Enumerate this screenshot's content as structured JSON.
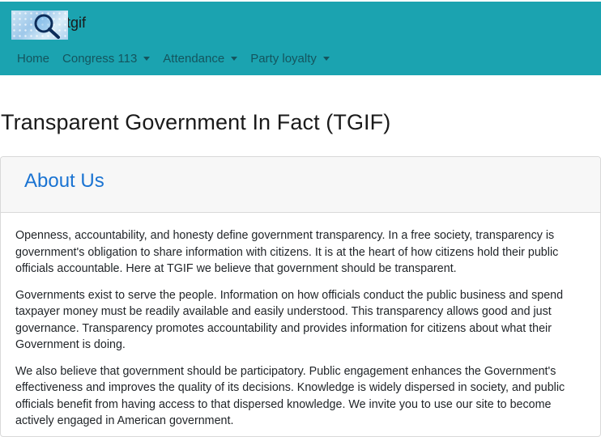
{
  "brand": {
    "name": "tgif",
    "logo_icon": "magnifying-glass-icon"
  },
  "nav": {
    "items": [
      {
        "label": "Home",
        "dropdown": false
      },
      {
        "label": "Congress 113",
        "dropdown": true
      },
      {
        "label": "Attendance",
        "dropdown": true
      },
      {
        "label": "Party loyalty",
        "dropdown": true
      }
    ]
  },
  "page": {
    "title": "Transparent Government In Fact (TGIF)"
  },
  "about": {
    "heading": "About Us",
    "paragraphs": [
      "Openness, accountability, and honesty define government transparency. In a free society, transparency is government's obligation to share information with citizens. It is at the heart of how citizens hold their public officials accountable. Here at TGIF we believe that government should be transparent.",
      "Governments exist to serve the people. Information on how officials conduct the public business and spend taxpayer money must be readily available and easily understood. This transparency allows good and just governance. Transparency promotes accountability and provides information for citizens about what their Government is doing.",
      "We also believe that government should be participatory. Public engagement enhances the Government's effectiveness and improves the quality of its decisions. Knowledge is widely dispersed in society, and public officials benefit from having access to that dispersed knowledge. We invite you to use our site to become actively engaged in American government."
    ]
  },
  "colors": {
    "navbar": "#1ba3b0",
    "nav_link": "#14555e",
    "heading_accent": "#1a73d2"
  }
}
